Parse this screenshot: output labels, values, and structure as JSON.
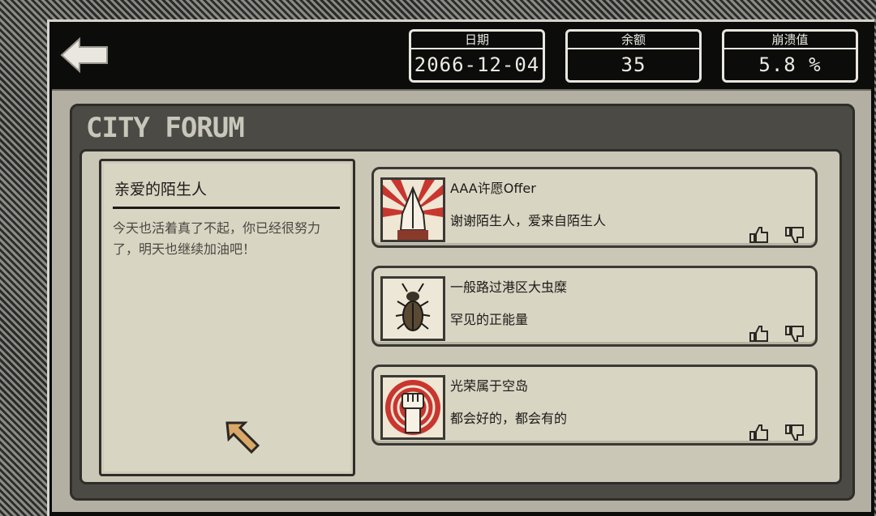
{
  "header": {
    "back_icon": "back-arrow-icon",
    "stats": [
      {
        "label": "日期",
        "value": "2066-12-04"
      },
      {
        "label": "余额",
        "value": "35"
      },
      {
        "label": "崩溃值",
        "value": "5.8 %"
      }
    ]
  },
  "forum": {
    "title": "CITY FORUM",
    "letter": {
      "title": "亲爱的陌生人",
      "body": "今天也活着真了不起，你已经很努力了，明天也继续加油吧！"
    },
    "posts": [
      {
        "name": "AAA许愿Offer",
        "text": "谢谢陌生人，爱来自陌生人",
        "avatar_icon": "praying-hands-icon"
      },
      {
        "name": "一般路过港区大虫糜",
        "text": "罕见的正能量",
        "avatar_icon": "beetle-icon"
      },
      {
        "name": "光荣属于空岛",
        "text": "都会好的，都会有的",
        "avatar_icon": "raised-fist-icon"
      }
    ]
  },
  "colors": {
    "accent_red": "#c8362f",
    "paper": "#d9d5c3",
    "frame_dark": "#0c0c0b"
  }
}
